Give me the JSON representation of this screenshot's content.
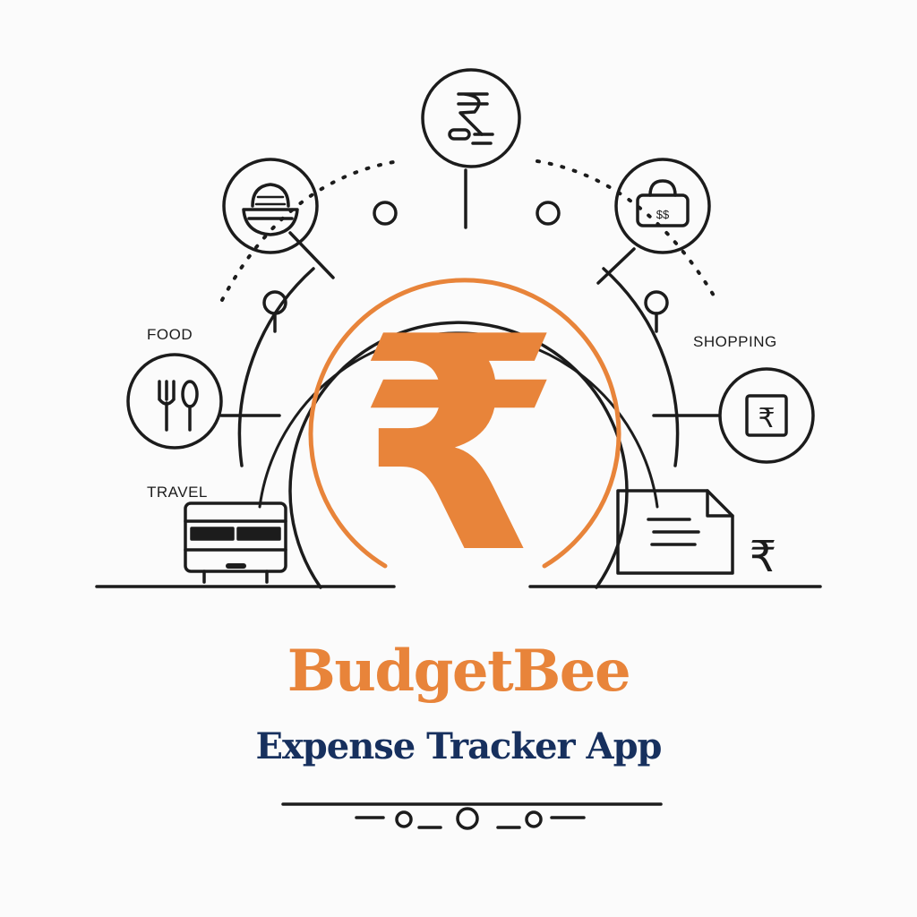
{
  "brand": {
    "name": "BudgetBee",
    "tagline": "Expense Tracker App"
  },
  "categories": {
    "food": "FOOD",
    "travel": "TRAVEL",
    "shopping": "SHOPPING"
  },
  "currency": {
    "main_symbol": "₹",
    "small_symbol": "₹",
    "badge_text": "$$"
  },
  "colors": {
    "accent": "#e8843a",
    "navy": "#17305e",
    "line": "#1c1c1c",
    "background": "#fbfbfb"
  },
  "icons": [
    "rupee-coin-icon",
    "food-bowl-icon",
    "shopping-bag-icon",
    "cutlery-icon",
    "rupee-card-icon",
    "bus-icon",
    "receipt-icon"
  ]
}
